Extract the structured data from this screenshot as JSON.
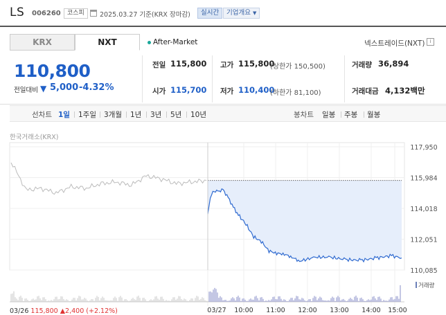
{
  "header": {
    "name": "LS",
    "code": "006260",
    "market_tag": "코스피",
    "date_text": "2025.03.27 기준(KRX 장마감)",
    "realtime_badge": "실시간",
    "company_info_badge": "기업개요"
  },
  "tabs": {
    "krx": "KRX",
    "nxt": "NXT"
  },
  "session": {
    "after_market": "After-Market",
    "nextrade": "넥스트레이드(NXT)",
    "info_glyph": "i"
  },
  "price": {
    "current": "110,800",
    "change_label": "전일대비",
    "change_arrow": "▼",
    "change_value": "5,000",
    "change_pct": "-4.32%"
  },
  "stats": {
    "prev_close_label": "전일",
    "prev_close": "115,800",
    "open_label": "시가",
    "open": "115,700",
    "high_label": "고가",
    "high": "115,800",
    "high_sub": "(상한가 150,500)",
    "low_label": "저가",
    "low": "110,400",
    "low_sub": "(하한가 81,100)",
    "volume_label": "거래량",
    "volume": "36,894",
    "amount_label": "거래대금",
    "amount": "4,132백만"
  },
  "period_bar": {
    "line_chart_label": "선차트",
    "periods": [
      "1일",
      "1주일",
      "3개월",
      "1년",
      "3년",
      "5년",
      "10년"
    ],
    "selected_period": "1일",
    "candle_chart_label": "봉차트",
    "candle_periods": [
      "일봉",
      "주봉",
      "월봉"
    ]
  },
  "chart_data": {
    "type": "line",
    "title": "한국거래소(KRX)",
    "y_ticks": [
      "117,950",
      "115,984",
      "114,018",
      "112,051",
      "110,085"
    ],
    "ylim": [
      110085,
      117950
    ],
    "x_ticks": [
      "03/27",
      "10:00",
      "11:00",
      "12:00",
      "13:00",
      "14:00",
      "15:00"
    ],
    "reference_line": 115800,
    "series": [
      {
        "x": [
          "03/26 09:00",
          "03/26 09:30",
          "03/26 10:00",
          "03/26 10:30",
          "03/26 11:00",
          "03/26 11:30",
          "03/26 12:00",
          "03/26 12:30",
          "03/26 13:00",
          "03/26 13:30",
          "03/26 14:00",
          "03/26 14:30",
          "03/26 15:00",
          "03/26 15:20"
        ],
        "values": [
          117000,
          115200,
          115300,
          115000,
          115400,
          115300,
          115600,
          115700,
          115500,
          116100,
          115900,
          115600,
          115700,
          115800
        ]
      },
      {
        "x": [
          "09:00",
          "09:05",
          "09:10",
          "09:20",
          "09:30",
          "09:40",
          "09:50",
          "10:00",
          "10:15",
          "10:30",
          "10:45",
          "11:00",
          "11:15",
          "11:30",
          "11:45",
          "12:00",
          "12:30",
          "13:00",
          "13:30",
          "14:00",
          "14:30",
          "15:00",
          "15:20"
        ],
        "values": [
          113700,
          114700,
          115100,
          115100,
          115200,
          114700,
          114100,
          113600,
          113000,
          112200,
          111900,
          111300,
          111150,
          111100,
          110900,
          110650,
          110900,
          110900,
          110750,
          110700,
          110850,
          111000,
          110850
        ]
      }
    ],
    "volume_label": "거래량"
  },
  "footer": {
    "date": "03/26",
    "price": "115,800",
    "change": "▲2,400",
    "pct": "(+2.12%)"
  },
  "colors": {
    "down_blue": "#1f5fc7",
    "up_red": "#e03131",
    "area_fill": "#e6eefb"
  }
}
